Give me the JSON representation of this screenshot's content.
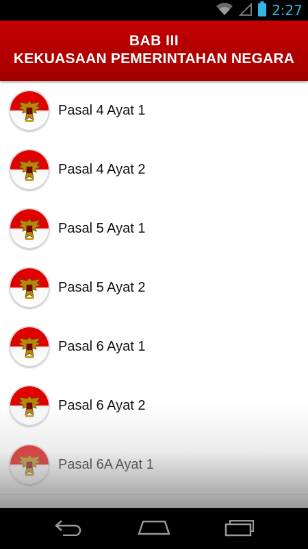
{
  "status_bar": {
    "time": "2:27",
    "icons": [
      "wifi-icon",
      "signal-icon",
      "battery-icon"
    ]
  },
  "header": {
    "line1": "BAB III",
    "line2": "KEKUASAAN PEMERINTAHAN NEGARA"
  },
  "list": {
    "items": [
      {
        "label": "Pasal 4 Ayat 1",
        "icon": "garuda-emblem-icon"
      },
      {
        "label": "Pasal 4 Ayat 2",
        "icon": "garuda-emblem-icon"
      },
      {
        "label": "Pasal 5 Ayat 1",
        "icon": "garuda-emblem-icon"
      },
      {
        "label": "Pasal 5 Ayat 2",
        "icon": "garuda-emblem-icon"
      },
      {
        "label": "Pasal 6 Ayat 1",
        "icon": "garuda-emblem-icon"
      },
      {
        "label": "Pasal 6 Ayat 2",
        "icon": "garuda-emblem-icon"
      },
      {
        "label": "Pasal 6A Ayat 1",
        "icon": "garuda-emblem-icon"
      }
    ]
  },
  "nav_bar": {
    "buttons": [
      "back-icon",
      "home-icon",
      "recent-apps-icon"
    ]
  },
  "colors": {
    "header_red": "#b10000",
    "clock_blue": "#33b5e5",
    "emblem_red": "#e00000"
  }
}
